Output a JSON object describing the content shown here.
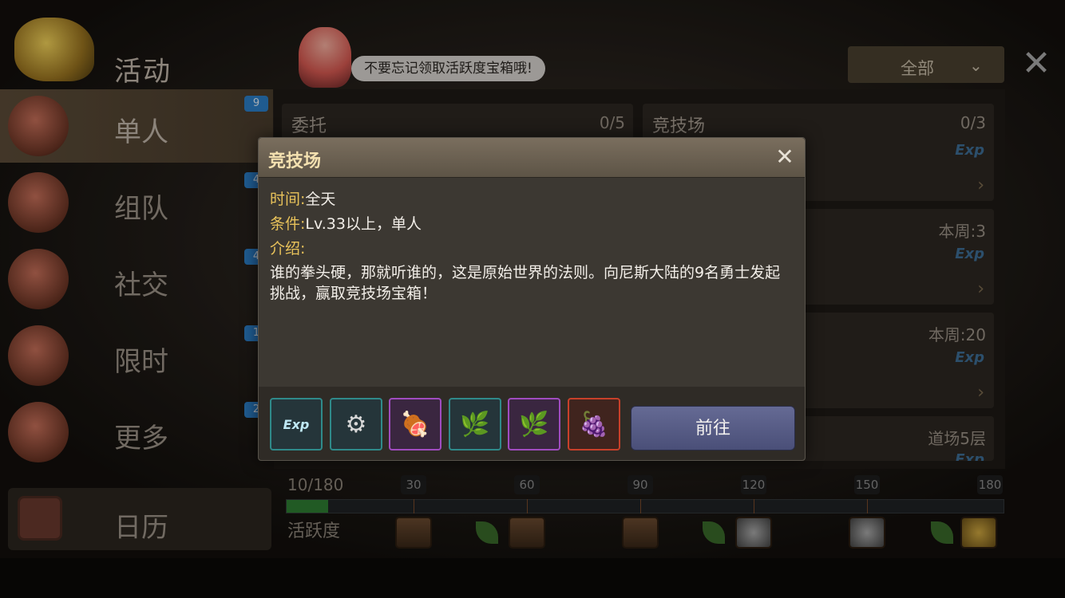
{
  "header": {
    "title": "活动",
    "tip": "不要忘记领取活跃度宝箱哦!",
    "filter": "全部",
    "close": "✕"
  },
  "sidebar": {
    "items": [
      {
        "label": "单人",
        "badge": "9",
        "active": true
      },
      {
        "label": "组队",
        "badge": "4",
        "active": false
      },
      {
        "label": "社交",
        "badge": "4",
        "active": false
      },
      {
        "label": "限时",
        "badge": "1",
        "active": false
      },
      {
        "label": "更多",
        "badge": "2",
        "active": false
      }
    ],
    "calendar": "日历"
  },
  "cards": [
    {
      "title": "委托",
      "count": "0/5"
    },
    {
      "title": "竞技场",
      "count": "0/3",
      "exp": "Exp",
      "arrow": "›"
    },
    {
      "count": "本周:3",
      "exp": "Exp",
      "arrow": "›"
    },
    {
      "count": "本周:20",
      "exp": "Exp",
      "arrow": "›"
    },
    {
      "count": "道场5层",
      "exp": "Exp"
    }
  ],
  "progress": {
    "count": "10/180",
    "label": "活跃度",
    "current": 10,
    "max": 180,
    "milestones": [
      "30",
      "60",
      "90",
      "120",
      "150",
      "180"
    ]
  },
  "modal": {
    "title": "竞技场",
    "time_key": "时间:",
    "time_value": "全天",
    "cond_key": "条件:",
    "cond_value": "Lv.33以上，单人",
    "intro_key": "介绍:",
    "description": "谁的拳头硬，那就听谁的，这是原始世界的法则。向尼斯大陆的9名勇士发起挑战，赢取竞技场宝箱！",
    "rewards": [
      {
        "icon": "exp-icon",
        "rarity": "teal",
        "label": "Exp"
      },
      {
        "icon": "ring-icon",
        "rarity": "teal"
      },
      {
        "icon": "meat-icon",
        "rarity": "purple"
      },
      {
        "icon": "berry-branch-icon",
        "rarity": "teal"
      },
      {
        "icon": "berry-branch-icon",
        "rarity": "purple"
      },
      {
        "icon": "grape-icon",
        "rarity": "red"
      }
    ],
    "go_label": "前往",
    "close": "✕"
  }
}
